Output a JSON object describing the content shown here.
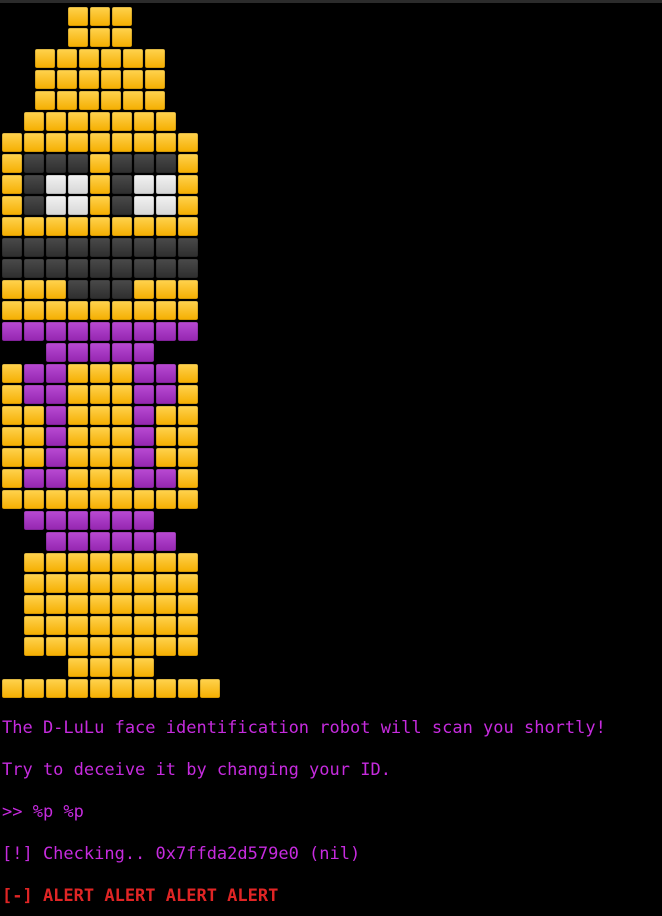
{
  "colors": {
    "background": "#000000",
    "robot_yellow": "#ffc11f",
    "robot_dark": "#3a3a3a",
    "robot_white": "#e6e6e6",
    "robot_purple": "#a733c2",
    "text_purple": "#c62bde",
    "alert_red": "#e02525"
  },
  "robot_art": {
    "legend": {
      "Y": "yellow",
      "D": "dark",
      "W": "white",
      "P": "purple",
      ".": "empty"
    },
    "rows": [
      [
        {
          "start": 3,
          "cells": "YYY"
        }
      ],
      [
        {
          "start": 3,
          "cells": "YYY"
        }
      ],
      [
        {
          "start": 1.5,
          "cells": "YYYYYY"
        }
      ],
      [
        {
          "start": 1.5,
          "cells": "YYYYYY"
        }
      ],
      [
        {
          "start": 1.5,
          "cells": "YYYYYY"
        }
      ],
      [
        {
          "start": 1,
          "cells": "YYYYYYY"
        }
      ],
      [
        {
          "start": 0,
          "cells": "YYYYYYYYY"
        }
      ],
      [
        {
          "start": 0,
          "cells": "YDDDYDDDY"
        }
      ],
      [
        {
          "start": 0,
          "cells": "YDWWYDWWY"
        }
      ],
      [
        {
          "start": 0,
          "cells": "YDWWYDWWY"
        }
      ],
      [
        {
          "start": 0,
          "cells": "YYYYYYYYY"
        }
      ],
      [
        {
          "start": 0,
          "cells": "DDDDDDDDD"
        }
      ],
      [
        {
          "start": 0,
          "cells": "DDDDDDDDD"
        }
      ],
      [
        {
          "start": 0,
          "cells": "YYYDDDYYY"
        }
      ],
      [
        {
          "start": 0,
          "cells": "YYYYYYYYY"
        }
      ],
      [
        {
          "start": 0,
          "cells": "PPPPPPPPP"
        }
      ],
      [
        {
          "start": 2,
          "cells": "PPPPP"
        }
      ],
      [
        {
          "start": 0,
          "cells": "YPPYYYPPY"
        }
      ],
      [
        {
          "start": 0,
          "cells": "YPPYYYPPY"
        }
      ],
      [
        {
          "start": 0,
          "cells": "YYPYYYPYY"
        }
      ],
      [
        {
          "start": 0,
          "cells": "YYPYYYPYY"
        }
      ],
      [
        {
          "start": 0,
          "cells": "YYPYYYPYY"
        }
      ],
      [
        {
          "start": 0,
          "cells": "YPPYYYPPY"
        }
      ],
      [
        {
          "start": 0,
          "cells": "YYYYYYYYY"
        }
      ],
      [
        {
          "start": 1,
          "cells": "PPPPPP"
        }
      ],
      [
        {
          "start": 2,
          "cells": "PPPPPP"
        }
      ],
      [
        {
          "start": 1,
          "cells": "YYYYYYYY"
        }
      ],
      [
        {
          "start": 1,
          "cells": "YYYYYYYY"
        }
      ],
      [
        {
          "start": 1,
          "cells": "YYYYYYYY"
        }
      ],
      [
        {
          "start": 1,
          "cells": "YYYYYYYY"
        }
      ],
      [
        {
          "start": 1,
          "cells": "YYYYYYYY"
        }
      ],
      [
        {
          "start": 3,
          "cells": "YYYY"
        }
      ],
      [
        {
          "start": 0,
          "cells": "YYYYYYYYYY"
        }
      ]
    ]
  },
  "output": {
    "line1": "The D-LuLu face identification robot will scan you shortly!",
    "line2": "Try to deceive it by changing your ID.",
    "line3": ">> %p %p",
    "line4": "[!] Checking.. 0x7ffda2d579e0 (nil)",
    "line5": "[-] ALERT ALERT ALERT ALERT"
  }
}
